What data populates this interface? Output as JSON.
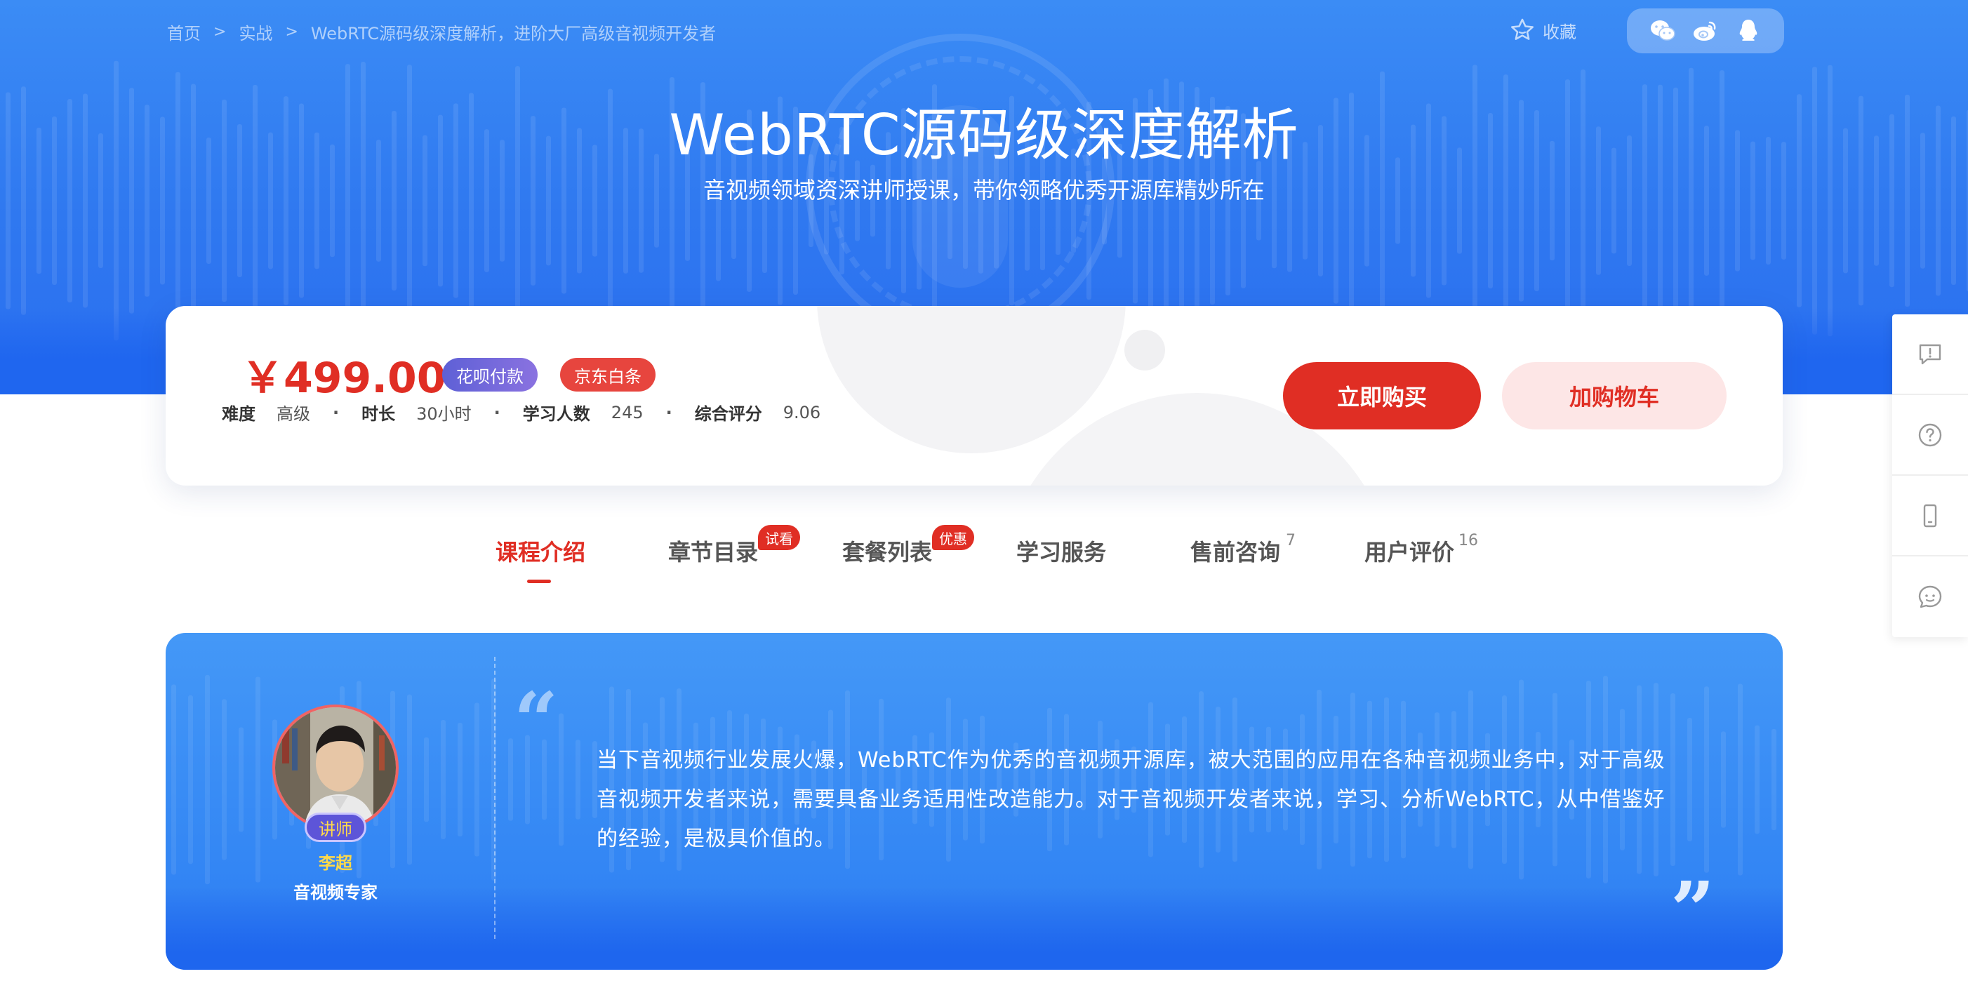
{
  "breadcrumb": {
    "items": [
      "首页",
      "实战",
      "WebRTC源码级深度解析，进阶大厂高级音视频开发者"
    ],
    "separator": ">"
  },
  "header": {
    "favorite_label": "收藏",
    "share_icons": [
      "wechat-icon",
      "weibo-icon",
      "qq-icon"
    ]
  },
  "hero": {
    "title": "WebRTC源码级深度解析",
    "subtitle": "音视频领域资深讲师授课，带你领略优秀开源库精妙所在"
  },
  "purchase": {
    "price": "￥499.00",
    "badge_huabei": "花呗付款",
    "badge_jd": "京东白条",
    "meta": [
      {
        "key": "难度",
        "value": "高级"
      },
      {
        "key": "时长",
        "value": "30小时"
      },
      {
        "key": "学习人数",
        "value": "245"
      },
      {
        "key": "综合评分",
        "value": "9.06"
      }
    ],
    "buy_label": "立即购买",
    "cart_label": "加购物车"
  },
  "tabs": [
    {
      "label": "课程介绍",
      "active": true
    },
    {
      "label": "章节目录",
      "tag": "试看"
    },
    {
      "label": "套餐列表",
      "tag": "优惠"
    },
    {
      "label": "学习服务"
    },
    {
      "label": "售前咨询",
      "count": "7"
    },
    {
      "label": "用户评价",
      "count": "16"
    }
  ],
  "lecturer": {
    "tag": "讲师",
    "name": "李超",
    "title": "音视频专家"
  },
  "intro": {
    "text": "当下音视频行业发展火爆，WebRTC作为优秀的音视频开源库，被大范围的应用在各种音视频业务中，对于高级音视频开发者来说，需要具备业务适用性改造能力。对于音视频开发者来说，学习、分析WebRTC，从中借鉴好的经验，是极具价值的。"
  },
  "sidebar_icons": [
    "feedback-icon",
    "help-icon",
    "mobile-icon",
    "chat-icon"
  ],
  "colors": {
    "accent": "#e02e24",
    "hero_blue": "#2f78f0",
    "gold": "#ffd94a"
  }
}
